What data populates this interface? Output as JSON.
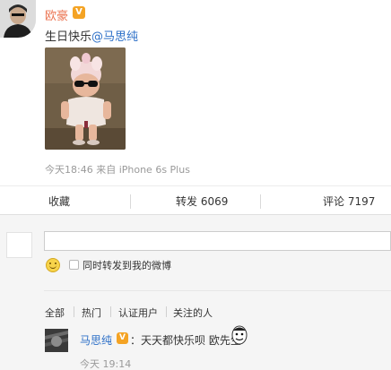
{
  "post": {
    "author_name": "欧豪",
    "verified_badge": "V",
    "text_prefix": "生日快乐",
    "mention": "@马思纯",
    "meta": "今天18:46 来自 iPhone 6s Plus",
    "avatar_icon": "user-avatar",
    "photo_icon": "doll-photo"
  },
  "actions": {
    "favorite_label": "收藏",
    "repost_label": "转发 6069",
    "comment_label": "评论 7197"
  },
  "composer": {
    "input_value": "",
    "emoji_icon": "smiley-icon",
    "repost_checkbox_label": "同时转发到我的微博",
    "repost_checked": false
  },
  "filters": {
    "tabs": [
      "全部",
      "热门",
      "认证用户",
      "关注的人"
    ]
  },
  "reply": {
    "author_name": "马思纯",
    "verified_badge": "V",
    "text": "：天天都快乐呗 欧先生",
    "time": "今天 19:14",
    "sticker_icon": "face-sticker"
  },
  "colors": {
    "author_orange": "#eb7350",
    "link_blue": "#2c6fc7",
    "badge_gold": "#f4a324",
    "meta_gray": "#9a9a9a",
    "comment_bg": "#f5f5f5"
  }
}
